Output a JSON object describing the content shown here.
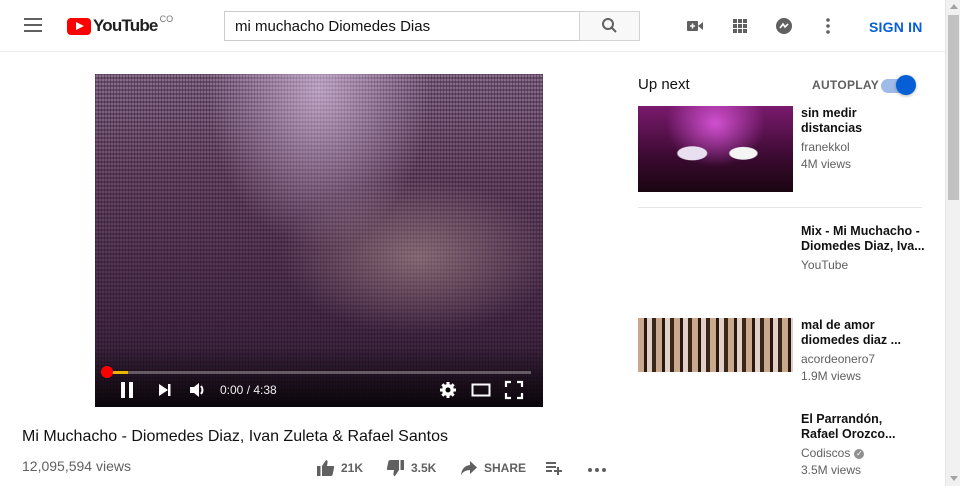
{
  "header": {
    "logo_text": "YouTube",
    "logo_country": "CO",
    "search_value": "mi muchacho Diomedes Dias",
    "signin_label": "SIGN IN"
  },
  "player": {
    "time_display": "0:00 / 4:38",
    "progress_buffered": 0.05,
    "state": "playing"
  },
  "video": {
    "title": "Mi Muchacho - Diomedes Diaz, Ivan Zuleta & Rafael Santos",
    "views": "12,095,594 views",
    "likes": "21K",
    "dislikes": "3.5K",
    "share_label": "SHARE"
  },
  "sidebar": {
    "up_next_label": "Up next",
    "autoplay_label": "AUTOPLAY",
    "autoplay_on": true,
    "items": [
      {
        "title_line1": "sin medir",
        "title_line2": "distancias",
        "channel": "franekkol",
        "views": "4M views"
      },
      {
        "title_line1": "Mix - Mi Muchacho -",
        "title_line2": "Diomedes Diaz, Iva...",
        "channel": "YouTube",
        "views": ""
      },
      {
        "title_line1": "mal de amor",
        "title_line2": "diomedes diaz ...",
        "channel": "acordeonero7",
        "views": "1.9M views"
      },
      {
        "title_line1": "El Parrandón,",
        "title_line2": "Rafael Orozco...",
        "channel": "Codiscos",
        "views": "3.5M views"
      }
    ]
  },
  "colors": {
    "brand_red": "#ff0000",
    "link_blue": "#065fd4",
    "progress_buffer": "#eeb500"
  }
}
